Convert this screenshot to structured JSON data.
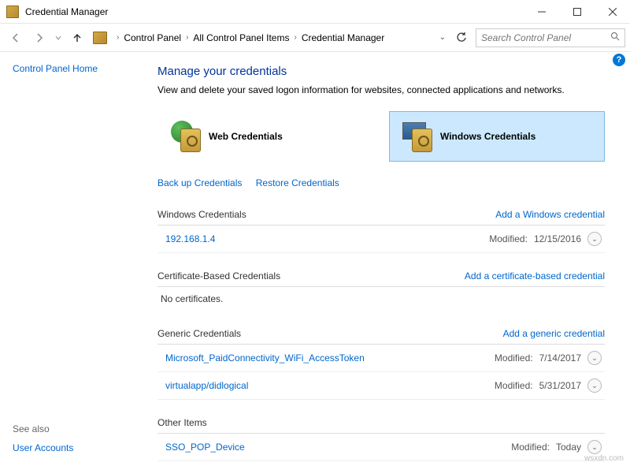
{
  "window": {
    "title": "Credential Manager"
  },
  "breadcrumb": {
    "items": [
      "Control Panel",
      "All Control Panel Items",
      "Credential Manager"
    ]
  },
  "search": {
    "placeholder": "Search Control Panel"
  },
  "sidebar": {
    "home": "Control Panel Home",
    "see_also": "See also",
    "user_accounts": "User Accounts"
  },
  "page": {
    "title": "Manage your credentials",
    "description": "View and delete your saved logon information for websites, connected applications and networks."
  },
  "tabs": {
    "web": "Web Credentials",
    "windows": "Windows Credentials"
  },
  "actions": {
    "backup": "Back up Credentials",
    "restore": "Restore Credentials"
  },
  "sections": {
    "windows": {
      "title": "Windows Credentials",
      "add": "Add a Windows credential",
      "items": [
        {
          "name": "192.168.1.4",
          "modified_label": "Modified:",
          "modified": "12/15/2016"
        }
      ]
    },
    "cert": {
      "title": "Certificate-Based Credentials",
      "add": "Add a certificate-based credential",
      "empty": "No certificates."
    },
    "generic": {
      "title": "Generic Credentials",
      "add": "Add a generic credential",
      "items": [
        {
          "name": "Microsoft_PaidConnectivity_WiFi_AccessToken",
          "modified_label": "Modified:",
          "modified": "7/14/2017"
        },
        {
          "name": "virtualapp/didlogical",
          "modified_label": "Modified:",
          "modified": "5/31/2017"
        }
      ]
    },
    "other": {
      "title": "Other Items",
      "items": [
        {
          "name": "SSO_POP_Device",
          "modified_label": "Modified:",
          "modified": "Today"
        }
      ]
    }
  },
  "watermark": "wsxdn.com"
}
